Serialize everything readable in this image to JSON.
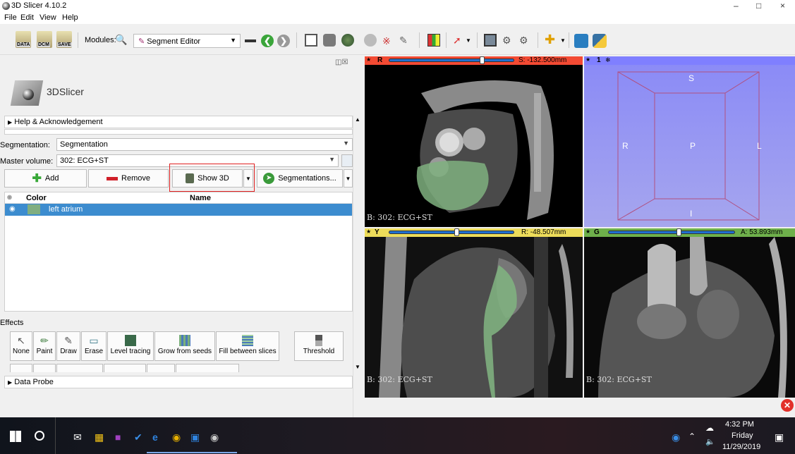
{
  "window": {
    "title": "3D Slicer 4.10.2",
    "controls": [
      "–",
      "□",
      "×"
    ]
  },
  "menubar": {
    "items": [
      "File",
      "Edit",
      "View",
      "Help"
    ]
  },
  "toolbar": {
    "modules_label": "Modules:",
    "module_selected": "Segment Editor",
    "data_label": "DATA",
    "dcm_label": "DCM",
    "save_label": "SAVE"
  },
  "panel": {
    "logo_text": "3DSlicer",
    "help_section": "Help & Acknowledgement",
    "segmentation_label": "Segmentation:",
    "segmentation_value": "Segmentation",
    "master_volume_label": "Master volume:",
    "master_volume_value": "302: ECG+ST",
    "add_label": "Add",
    "remove_label": "Remove",
    "show3d_label": "Show 3D",
    "segmentations_label": "Segmentations...",
    "table": {
      "col_color": "Color",
      "col_name": "Name",
      "rows": [
        {
          "name": "left atrium",
          "color": "#80ae80"
        }
      ]
    },
    "effects_label": "Effects",
    "effects": [
      "None",
      "Paint",
      "Draw",
      "Erase",
      "Level tracing",
      "Grow from seeds",
      "Fill between slices",
      "Threshold"
    ],
    "data_probe": "Data Probe"
  },
  "views": {
    "red": {
      "letter": "R",
      "offset": "S: -132.500mm",
      "label": "B: 302: ECG+ST",
      "color": "#f34a33"
    },
    "threeD": {
      "letter": "1",
      "labels": {
        "s": "S",
        "r": "R",
        "p": "P",
        "l": "L",
        "i": "I"
      },
      "color": "#7f7fff"
    },
    "yellow": {
      "letter": "Y",
      "offset": "R: -48.507mm",
      "label": "B: 302: ECG+ST",
      "color": "#eddc5a"
    },
    "green": {
      "letter": "G",
      "offset": "A: 53.893mm",
      "label": "B: 302: ECG+ST",
      "color": "#6eb04b"
    }
  },
  "taskbar": {
    "time": "4:32 PM",
    "day": "Friday",
    "date": "11/29/2019"
  }
}
